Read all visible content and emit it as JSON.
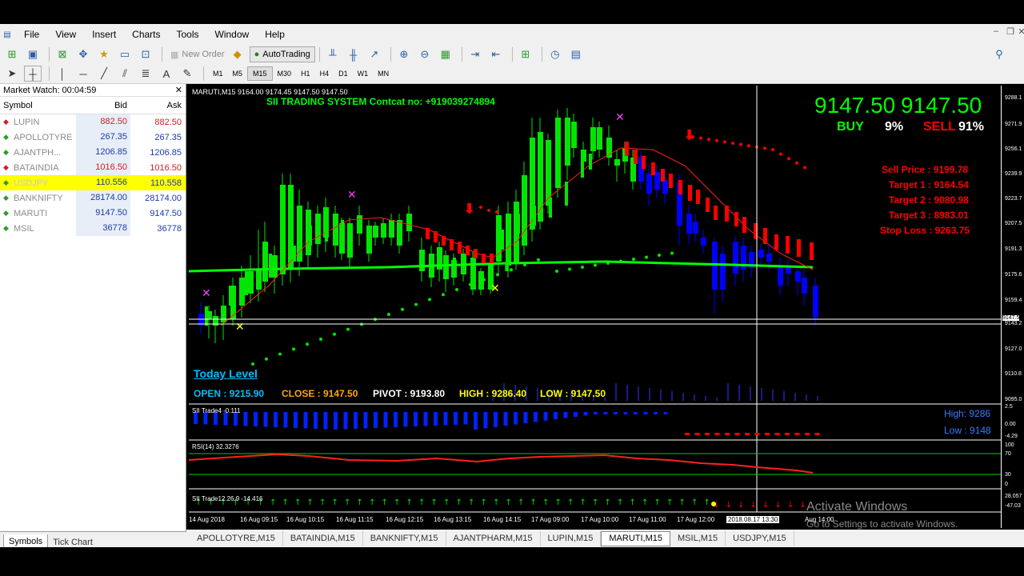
{
  "menu": [
    "File",
    "View",
    "Insert",
    "Charts",
    "Tools",
    "Window",
    "Help"
  ],
  "toolbar": {
    "new_order": "New Order",
    "autotrading": "AutoTrading"
  },
  "timeframes": [
    "M1",
    "M5",
    "M15",
    "M30",
    "H1",
    "H4",
    "D1",
    "W1",
    "MN"
  ],
  "active_timeframe": "M15",
  "market_watch": {
    "title": "Market Watch: 00:04:59",
    "col_symbol": "Symbol",
    "col_bid": "Bid",
    "col_ask": "Ask",
    "rows": [
      {
        "symbol": "LUPIN",
        "bid": "882.50",
        "ask": "882.50",
        "dir": "down"
      },
      {
        "symbol": "APOLLOTYRE",
        "bid": "267.35",
        "ask": "267.35",
        "dir": "up"
      },
      {
        "symbol": "AJANTPH...",
        "bid": "1206.85",
        "ask": "1206.85",
        "dir": "up"
      },
      {
        "symbol": "BATAINDIA",
        "bid": "1016.50",
        "ask": "1016.50",
        "dir": "down"
      },
      {
        "symbol": "USDJPY",
        "bid": "110.556",
        "ask": "110.558",
        "dir": "up",
        "highlight": true
      },
      {
        "symbol": "BANKNIFTY",
        "bid": "28174.00",
        "ask": "28174.00",
        "dir": "up"
      },
      {
        "symbol": "MARUTI",
        "bid": "9147.50",
        "ask": "9147.50",
        "dir": "up"
      },
      {
        "symbol": "MSIL",
        "bid": "36778",
        "ask": "36778",
        "dir": "up"
      }
    ],
    "tabs": [
      "Symbols",
      "Tick Chart"
    ]
  },
  "chart": {
    "header": "MARUTI,M15  9164.00 9174.45 9147.50 9147.50",
    "system_title": "SII TRADING SYSTEM  Contcat no: +919039274894",
    "big_price_1": "9147.50",
    "big_price_2": "9147.50",
    "buy_label": "BUY",
    "buy_pct": "9%",
    "sell_label": "SELL",
    "sell_pct": "91%",
    "sell_price": "Sell Price :    9199.78",
    "target1": "Target 1 :    9164.54",
    "target2": "Target 2 :    9080.98",
    "target3": "Target 3 :    8983.01",
    "stop_loss": "Stop Loss :    9263.75",
    "today_level": "Today Level",
    "open": "OPEN : 9215.90",
    "close": "CLOSE : 9147.50",
    "pivot": "PIVOT : 9193.80",
    "high": "HIGH : 9286.40",
    "low": "LOW  : 9147.50",
    "trade4_label": "SII Trade4 -0.111",
    "high_lbl": "High: 9286",
    "low_lbl": "Low : 9148",
    "rsi_label": "RSI(14) 32.3276",
    "trade12_label": "SII Trade12.26.9 -14.416",
    "watermark_1": "Activate Windows",
    "watermark_2": "Go to Settings to activate Windows.",
    "crosshair_time": "2018.08.17 13:30",
    "time_labels": [
      "14 Aug 2018",
      "16 Aug 09:15",
      "16 Aug 10:15",
      "16 Aug 11:15",
      "16 Aug 12:15",
      "16 Aug 13:15",
      "16 Aug 14:15",
      "17 Aug 09:00",
      "17 Aug 10:00",
      "17 Aug 11:00",
      "17 Aug 12:00",
      "Aug 14:00"
    ],
    "price_labels": [
      "9288.1",
      "9271.9",
      "9256.1",
      "9239.9",
      "9223.7",
      "9207.5",
      "9191.3",
      "9175.6",
      "9159.4",
      "9143.2",
      "9127.0",
      "9110.8",
      "9095.0"
    ],
    "current_price_tag": "9147.5",
    "sub_scale_1": [
      "2.5",
      "0.00",
      "-4.29"
    ],
    "rsi_scale": [
      "100",
      "70",
      "30",
      "0"
    ],
    "sub_scale_3": [
      "28.057",
      "-47.03"
    ]
  },
  "symbol_tabs": [
    "APOLLOTYRE,M15",
    "BATAINDIA,M15",
    "BANKNIFTY,M15",
    "AJANTPHARM,M15",
    "LUPIN,M15",
    "MARUTI,M15",
    "MSIL,M15",
    "USDJPY,M15"
  ],
  "active_symbol_tab": "MARUTI,M15",
  "colors": {
    "bull": "#00e600",
    "bear": "#0000ff",
    "sell": "#ff0000",
    "green_text": "#00ff00",
    "cyan": "#00bfff",
    "orange": "#ffa500",
    "yellow": "#ffff00",
    "magenta": "#ff3cff"
  }
}
